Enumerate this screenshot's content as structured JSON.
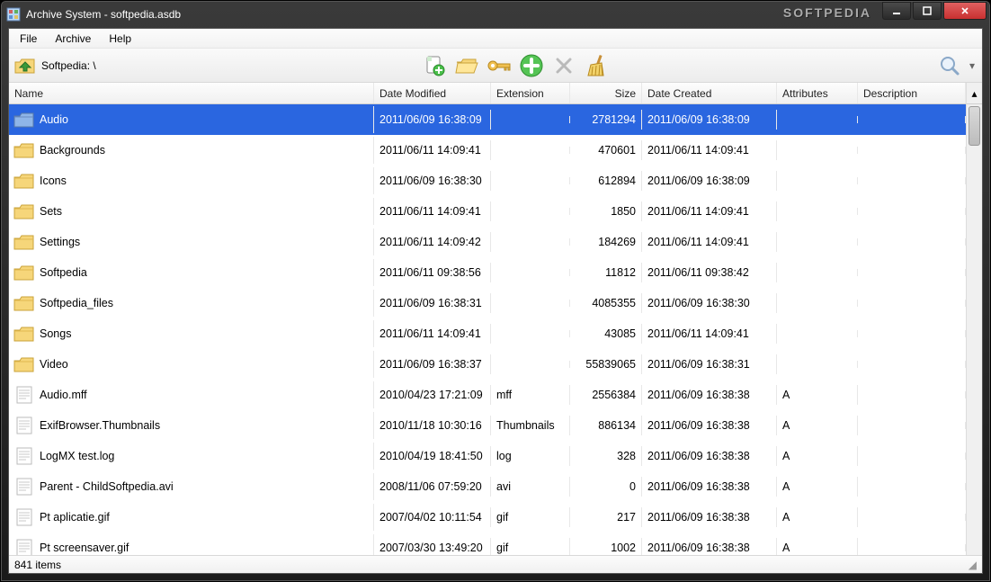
{
  "window": {
    "title": "Archive System - softpedia.asdb",
    "watermark": "SOFTPEDIA"
  },
  "menu": {
    "file": "File",
    "archive": "Archive",
    "help": "Help"
  },
  "toolbar": {
    "path": "Softpedia:  \\"
  },
  "columns": {
    "name": "Name",
    "dmod": "Date Modified",
    "ext": "Extension",
    "size": "Size",
    "dcrt": "Date Created",
    "attr": "Attributes",
    "desc": "Description"
  },
  "status": {
    "text": "841 items"
  },
  "rows": [
    {
      "kind": "folder",
      "selected": true,
      "name": "Audio",
      "dmod": "2011/06/09 16:38:09",
      "ext": "",
      "size": "2781294",
      "dcrt": "2011/06/09 16:38:09",
      "attr": "",
      "desc": ""
    },
    {
      "kind": "folder",
      "selected": false,
      "name": "Backgrounds",
      "dmod": "2011/06/11 14:09:41",
      "ext": "",
      "size": "470601",
      "dcrt": "2011/06/11 14:09:41",
      "attr": "",
      "desc": ""
    },
    {
      "kind": "folder",
      "selected": false,
      "name": "Icons",
      "dmod": "2011/06/09 16:38:30",
      "ext": "",
      "size": "612894",
      "dcrt": "2011/06/09 16:38:09",
      "attr": "",
      "desc": ""
    },
    {
      "kind": "folder",
      "selected": false,
      "name": "Sets",
      "dmod": "2011/06/11 14:09:41",
      "ext": "",
      "size": "1850",
      "dcrt": "2011/06/11 14:09:41",
      "attr": "",
      "desc": ""
    },
    {
      "kind": "folder",
      "selected": false,
      "name": "Settings",
      "dmod": "2011/06/11 14:09:42",
      "ext": "",
      "size": "184269",
      "dcrt": "2011/06/11 14:09:41",
      "attr": "",
      "desc": ""
    },
    {
      "kind": "folder",
      "selected": false,
      "name": "Softpedia",
      "dmod": "2011/06/11 09:38:56",
      "ext": "",
      "size": "11812",
      "dcrt": "2011/06/11 09:38:42",
      "attr": "",
      "desc": ""
    },
    {
      "kind": "folder",
      "selected": false,
      "name": "Softpedia_files",
      "dmod": "2011/06/09 16:38:31",
      "ext": "",
      "size": "4085355",
      "dcrt": "2011/06/09 16:38:30",
      "attr": "",
      "desc": ""
    },
    {
      "kind": "folder",
      "selected": false,
      "name": "Songs",
      "dmod": "2011/06/11 14:09:41",
      "ext": "",
      "size": "43085",
      "dcrt": "2011/06/11 14:09:41",
      "attr": "",
      "desc": ""
    },
    {
      "kind": "folder",
      "selected": false,
      "name": "Video",
      "dmod": "2011/06/09 16:38:37",
      "ext": "",
      "size": "55839065",
      "dcrt": "2011/06/09 16:38:31",
      "attr": "",
      "desc": ""
    },
    {
      "kind": "file",
      "selected": false,
      "name": "Audio.mff",
      "dmod": "2010/04/23 17:21:09",
      "ext": "mff",
      "size": "2556384",
      "dcrt": "2011/06/09 16:38:38",
      "attr": "A",
      "desc": ""
    },
    {
      "kind": "file",
      "selected": false,
      "name": "ExifBrowser.Thumbnails",
      "dmod": "2010/11/18 10:30:16",
      "ext": "Thumbnails",
      "size": "886134",
      "dcrt": "2011/06/09 16:38:38",
      "attr": "A",
      "desc": ""
    },
    {
      "kind": "file",
      "selected": false,
      "name": "LogMX test.log",
      "dmod": "2010/04/19 18:41:50",
      "ext": "log",
      "size": "328",
      "dcrt": "2011/06/09 16:38:38",
      "attr": "A",
      "desc": ""
    },
    {
      "kind": "file",
      "selected": false,
      "name": "Parent - ChildSoftpedia.avi",
      "dmod": "2008/11/06 07:59:20",
      "ext": "avi",
      "size": "0",
      "dcrt": "2011/06/09 16:38:38",
      "attr": "A",
      "desc": ""
    },
    {
      "kind": "file",
      "selected": false,
      "name": "Pt aplicatie.gif",
      "dmod": "2007/04/02 10:11:54",
      "ext": "gif",
      "size": "217",
      "dcrt": "2011/06/09 16:38:38",
      "attr": "A",
      "desc": ""
    },
    {
      "kind": "file",
      "selected": false,
      "name": "Pt screensaver.gif",
      "dmod": "2007/03/30 13:49:20",
      "ext": "gif",
      "size": "1002",
      "dcrt": "2011/06/09 16:38:38",
      "attr": "A",
      "desc": ""
    }
  ]
}
